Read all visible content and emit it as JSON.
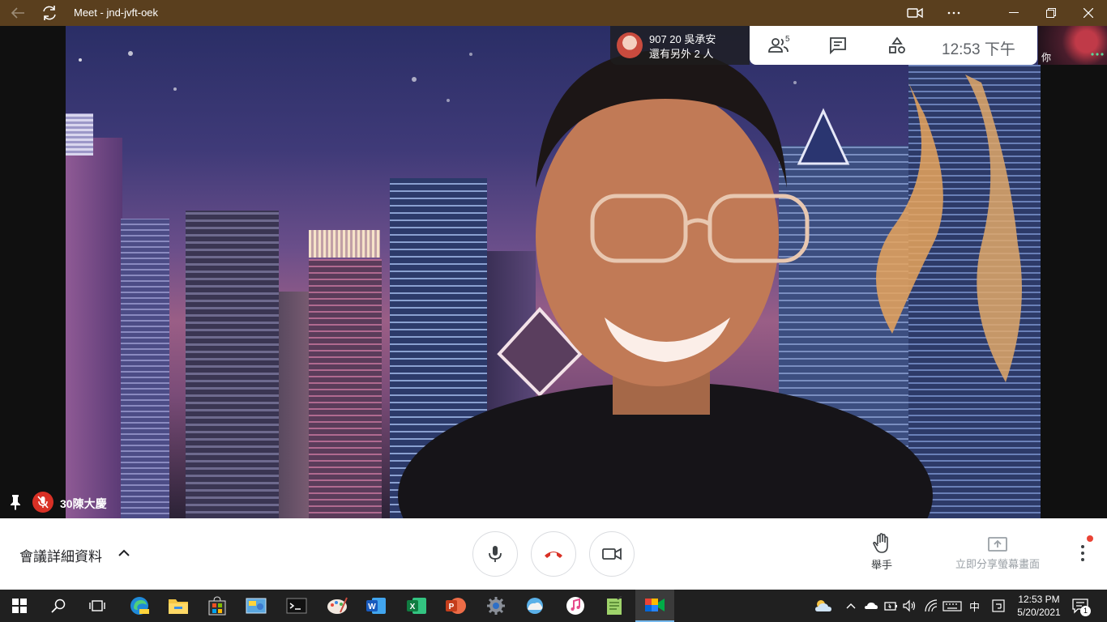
{
  "window": {
    "title": "Meet - jnd-jvft-oek"
  },
  "stage": {
    "speaker_name": "30陳大慶"
  },
  "presenter": {
    "name": "907 20 吳承安",
    "more": "還有另外 2 人"
  },
  "toolbar": {
    "people_count": "5",
    "clock": "12:53  下午"
  },
  "self_tile": {
    "label": "你"
  },
  "bottombar": {
    "details_label": "會議詳細資料",
    "raise_hand_label": "舉手",
    "share_label": "立即分享螢幕畫面"
  },
  "taskbar": {
    "ime": "中",
    "time": "12:53 PM",
    "date": "5/20/2021",
    "notification_count": "1",
    "apps": [
      "start",
      "search",
      "task-view",
      "edge",
      "file-explorer",
      "store",
      "control-panel",
      "terminal",
      "paint",
      "word",
      "excel",
      "powerpoint",
      "settings",
      "weather-app",
      "itunes",
      "notepad",
      "meet"
    ]
  },
  "colors": {
    "titlebar": "#5a3f1e",
    "end_call_red": "#d93025",
    "taskbar": "#202020"
  }
}
